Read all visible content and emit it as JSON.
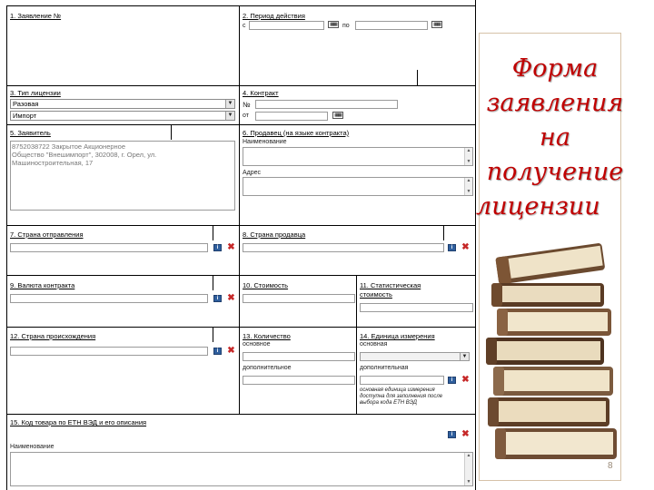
{
  "form": {
    "f1": {
      "label": "1. Заявление №"
    },
    "f2": {
      "label": "2. Период действия",
      "from": "с",
      "to": "по"
    },
    "f3": {
      "label": "3. Тип лицензии",
      "option1": "Разовая",
      "option2": "Импорт"
    },
    "f4": {
      "label": "4. Контракт",
      "no": "№",
      "from": "от"
    },
    "f5": {
      "label": "5. Заявитель",
      "value": "8752038722 Закрытое Акционерное\nОбщество \"Внешимпорт\", 302008, г. Орел, ул.\nМашиностроительная, 17"
    },
    "f6": {
      "label": "6. Продавец (на языке контракта)",
      "name": "Наименование",
      "address": "Адрес"
    },
    "f7": {
      "label": "7. Страна отправления"
    },
    "f8": {
      "label": "8. Страна продавца"
    },
    "f9": {
      "label": "9. Валюта контракта"
    },
    "f10": {
      "label": "10. Стоимость"
    },
    "f11": {
      "label": "11. Статистическая",
      "label2": "стоимость"
    },
    "f12": {
      "label": "12. Страна происхождения"
    },
    "f13": {
      "label": "13. Количество",
      "basic": "основное",
      "additional": "дополнительное"
    },
    "f14": {
      "label": "14. Единица измерения",
      "basic": "основная",
      "additional": "дополнительная",
      "note": "основная единица измерения\nдоступна для заполнения после\nвыбора кода ЕТН ВЭД"
    },
    "f15": {
      "label": "15. Код товара по ЕТН ВЭД и его описания",
      "name": "Наименование"
    }
  },
  "panel": {
    "title_lines": [
      "Форма",
      "заявления",
      "на",
      "получение",
      "лицензии"
    ],
    "page_number": "8"
  },
  "icons": {
    "add": "add-icon",
    "delete": "delete-icon",
    "calendar": "calendar-icon",
    "dropdown": "chevron-down-icon"
  },
  "colors": {
    "title": "#c00000",
    "delete": "#c62828",
    "add": "#2f5f9e"
  }
}
